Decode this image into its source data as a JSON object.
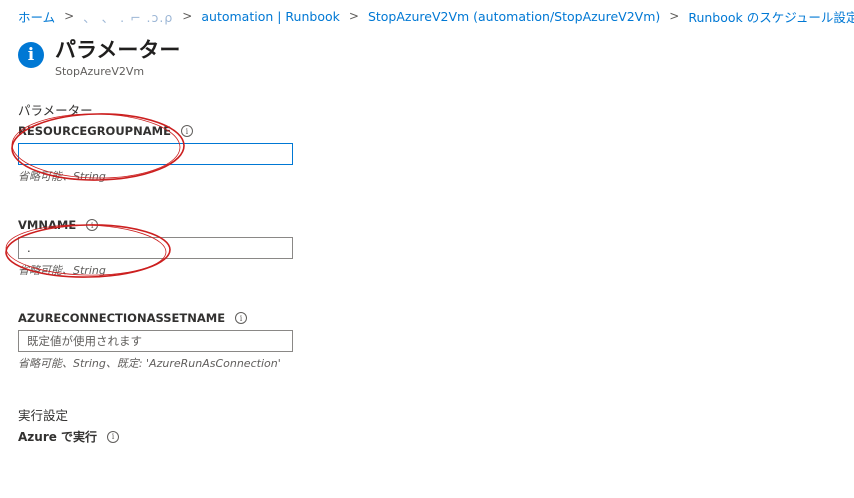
{
  "breadcrumb": {
    "items": [
      {
        "label": "ホーム"
      },
      {
        "label": "、  、 .  ⌐ .ɔ.ρ"
      },
      {
        "label": "automation | Runbook"
      },
      {
        "label": "StopAzureV2Vm (automation/StopAzureV2Vm)"
      },
      {
        "label": "Runbook のスケジュール設定"
      }
    ],
    "separator": ">"
  },
  "header": {
    "icon": "info-icon",
    "icon_glyph": "i",
    "title": "パラメーター",
    "subtitle": "StopAzureV2Vm"
  },
  "parameters": {
    "section_label": "パラメーター",
    "fields": [
      {
        "label": "RESOURCEGROUPNAME",
        "value": "",
        "placeholder": "",
        "hint": "省略可能、String"
      },
      {
        "label": "VMNAME",
        "value": ".",
        "placeholder": "",
        "hint": "省略可能、String"
      },
      {
        "label": "AZURECONNECTIONASSETNAME",
        "value": "",
        "placeholder": "既定値が使用されます",
        "hint": "省略可能、String、既定: 'AzureRunAsConnection'"
      }
    ]
  },
  "run_settings": {
    "section_label": "実行設定",
    "run_on_label": "Azure で実行"
  },
  "info_glyph": "i",
  "colors": {
    "accent": "#0078d4",
    "annotation": "#cc1f1f"
  }
}
